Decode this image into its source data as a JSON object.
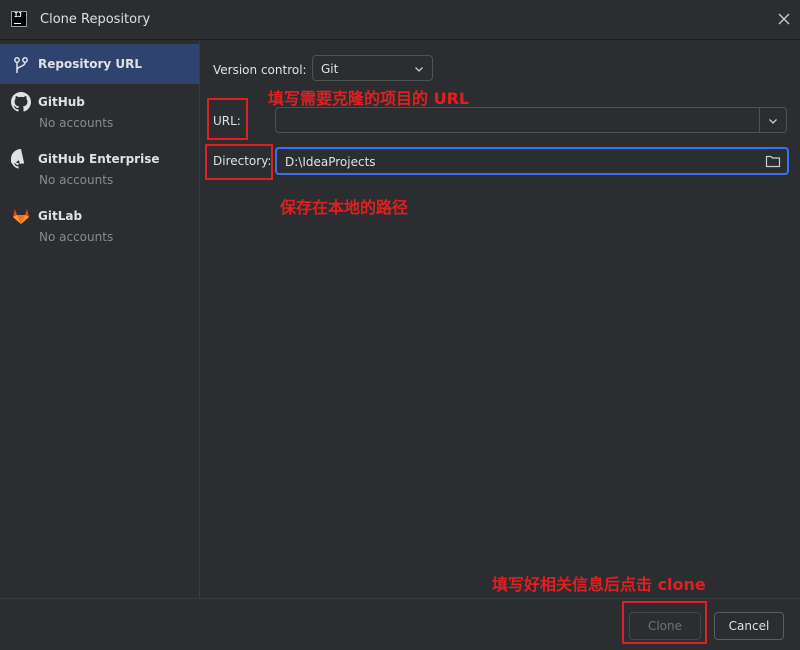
{
  "window": {
    "title": "Clone Repository",
    "icon": "intellij-icon",
    "close_icon": "close-icon"
  },
  "sidebar": {
    "items": [
      {
        "label": "Repository URL",
        "sub": "",
        "icon": "vcs-branch-icon",
        "selected": true
      },
      {
        "label": "GitHub",
        "sub": "No accounts",
        "icon": "github-icon"
      },
      {
        "label": "GitHub Enterprise",
        "sub": "No accounts",
        "icon": "github-icon"
      },
      {
        "label": "GitLab",
        "sub": "No accounts",
        "icon": "gitlab-icon"
      }
    ]
  },
  "form": {
    "version_control_label": "Version control:",
    "version_control_value": "Git",
    "url_label": "URL:",
    "url_value": "",
    "directory_label": "Directory:",
    "directory_value": "D:\\IdeaProjects"
  },
  "annotations": {
    "url_note": "填写需要克隆的项目的 URL",
    "dir_note": "保存在本地的路径",
    "clone_note": "填写好相关信息后点击 clone",
    "color": "#e02020"
  },
  "footer": {
    "clone_label": "Clone",
    "cancel_label": "Cancel"
  },
  "colors": {
    "background": "#2b2d30",
    "selection": "#2e436e",
    "focus_border": "#3574f0"
  }
}
